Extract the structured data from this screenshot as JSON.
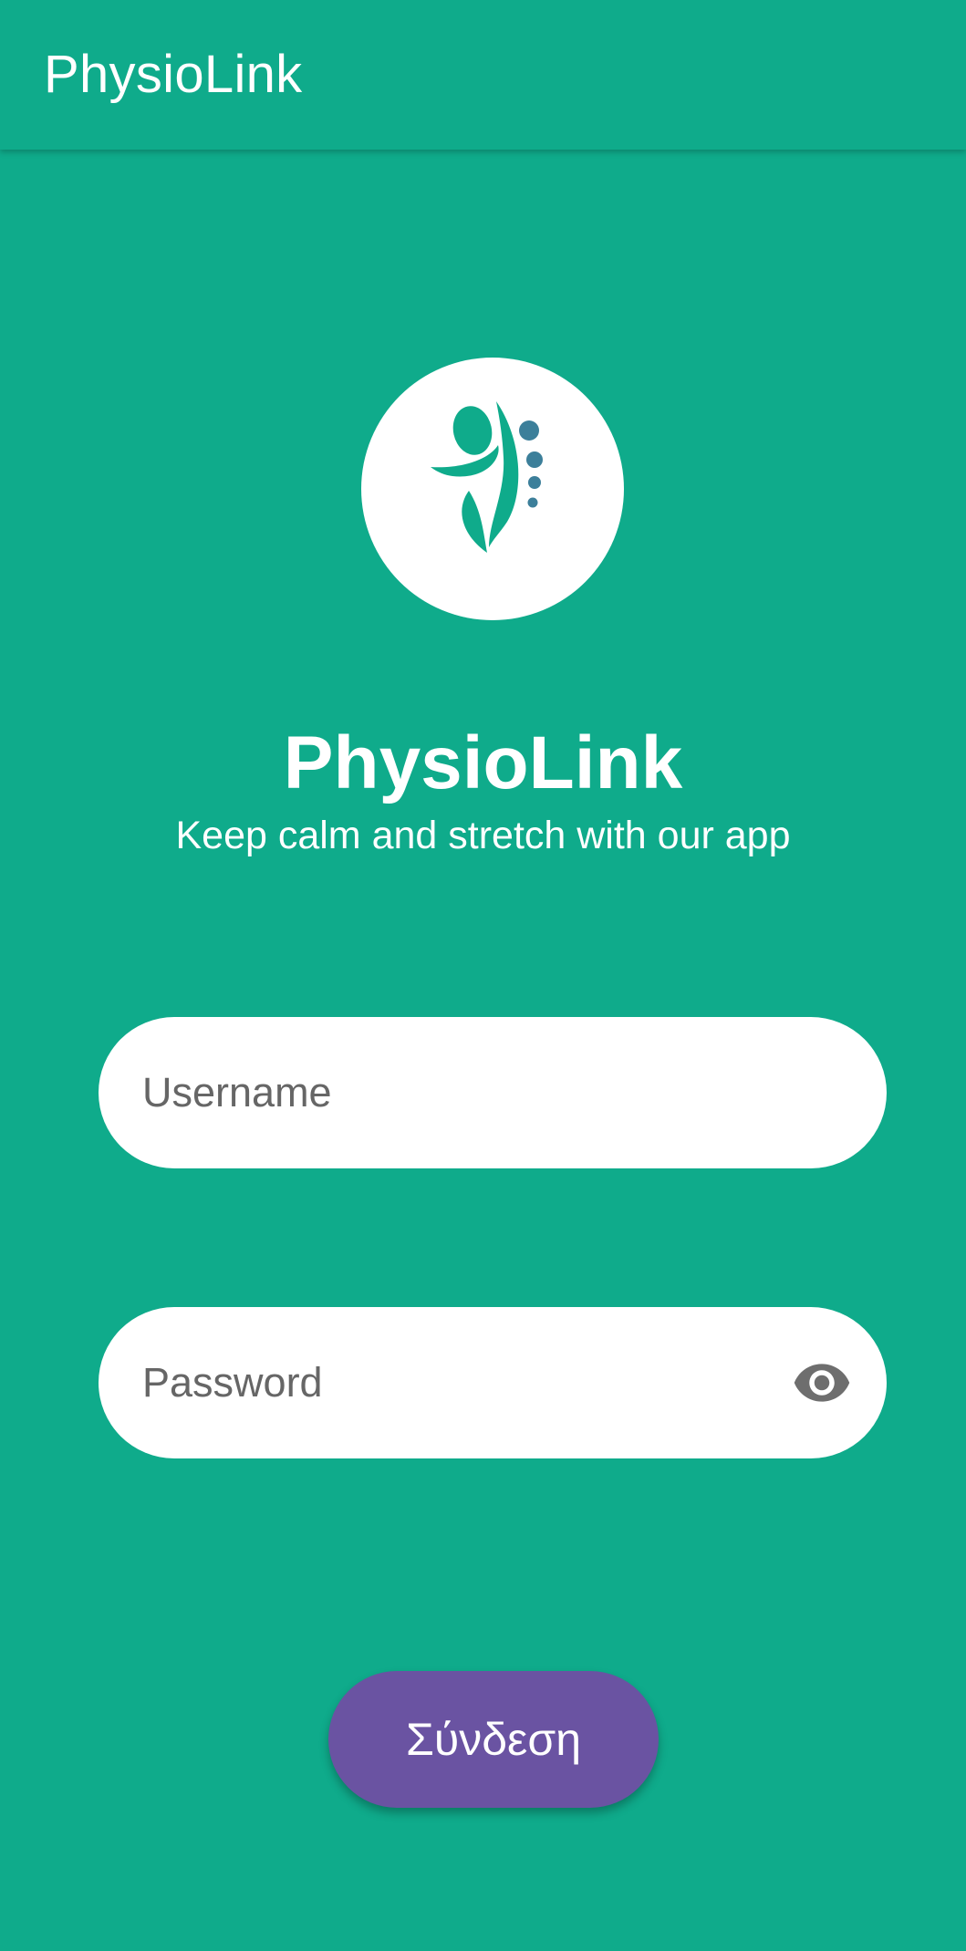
{
  "app_bar": {
    "title": "PhysioLink"
  },
  "brand": {
    "logo_icon": "physio-figure-logo-icon",
    "title": "PhysioLink",
    "tagline": "Keep calm and stretch with our app"
  },
  "form": {
    "username_placeholder": "Username",
    "username_value": "",
    "password_placeholder": "Password",
    "password_value": "",
    "password_toggle_icon": "eye-icon",
    "login_label": "Σύνδεση"
  },
  "colors": {
    "background": "#0fab8b",
    "primary_button": "#6a53a2",
    "field_background": "#ffffff",
    "placeholder_text": "#666666",
    "logo_green": "#0fab8b",
    "logo_dots": "#3c7f9a"
  }
}
